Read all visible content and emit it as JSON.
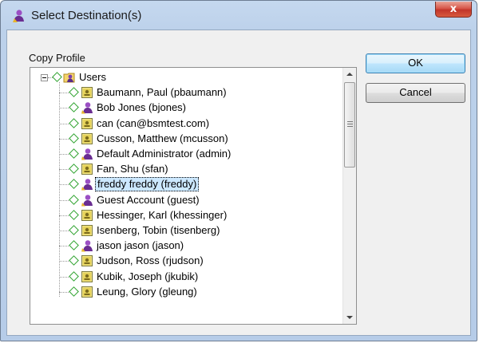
{
  "window": {
    "title": "Select Destination(s)",
    "close_label": "x"
  },
  "dialog": {
    "group_label": "Copy Profile",
    "ok_label": "OK",
    "cancel_label": "Cancel"
  },
  "tree": {
    "root_label": "Users",
    "items": [
      {
        "label": "Baumann, Paul (pbaumann)",
        "icon": "contact-card-icon"
      },
      {
        "label": "Bob Jones (bjones)",
        "icon": "user-icon"
      },
      {
        "label": "can (can@bsmtest.com)",
        "icon": "contact-card-icon"
      },
      {
        "label": "Cusson, Matthew (mcusson)",
        "icon": "contact-card-icon"
      },
      {
        "label": "Default Administrator (admin)",
        "icon": "user-icon"
      },
      {
        "label": "Fan, Shu (sfan)",
        "icon": "contact-card-icon"
      },
      {
        "label": "freddy freddy (freddy)",
        "icon": "user-icon",
        "selected": true
      },
      {
        "label": "Guest Account (guest)",
        "icon": "user-icon"
      },
      {
        "label": "Hessinger, Karl (khessinger)",
        "icon": "contact-card-icon"
      },
      {
        "label": "Isenberg, Tobin (tisenberg)",
        "icon": "contact-card-icon"
      },
      {
        "label": "jason jason (jason)",
        "icon": "user-icon"
      },
      {
        "label": "Judson, Ross (rjudson)",
        "icon": "contact-card-icon"
      },
      {
        "label": "Kubik, Joseph (jkubik)",
        "icon": "contact-card-icon"
      },
      {
        "label": "Leung, Glory (gleung)",
        "icon": "contact-card-icon"
      }
    ]
  },
  "colors": {
    "selection": "#cce8ff",
    "diamond": "#2ea32e",
    "close_button": "#c2352a"
  }
}
